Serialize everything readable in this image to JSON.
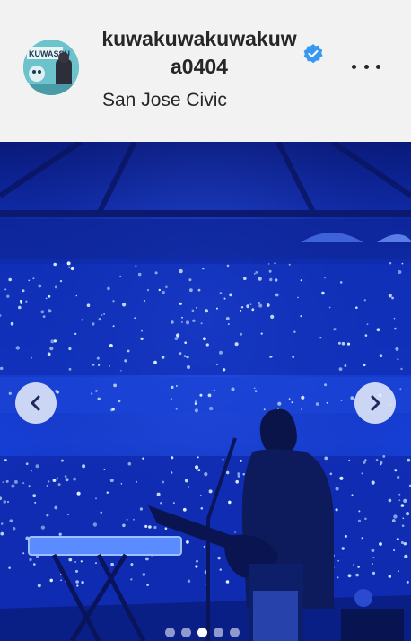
{
  "post": {
    "username": "kuwakuwakuwakuwa0404",
    "location": "San Jose Civic",
    "verified": true,
    "avatar_icon": "band-banner-avatar",
    "avatar_text": "KUWASSU"
  },
  "carousel": {
    "current_index": 3,
    "total": 5,
    "prev_icon": "chevron-left-icon",
    "next_icon": "chevron-right-icon"
  },
  "colors": {
    "header_bg": "#f2f2f2",
    "verified_blue": "#3897f0",
    "photo_blue": "#0a1fa8"
  }
}
